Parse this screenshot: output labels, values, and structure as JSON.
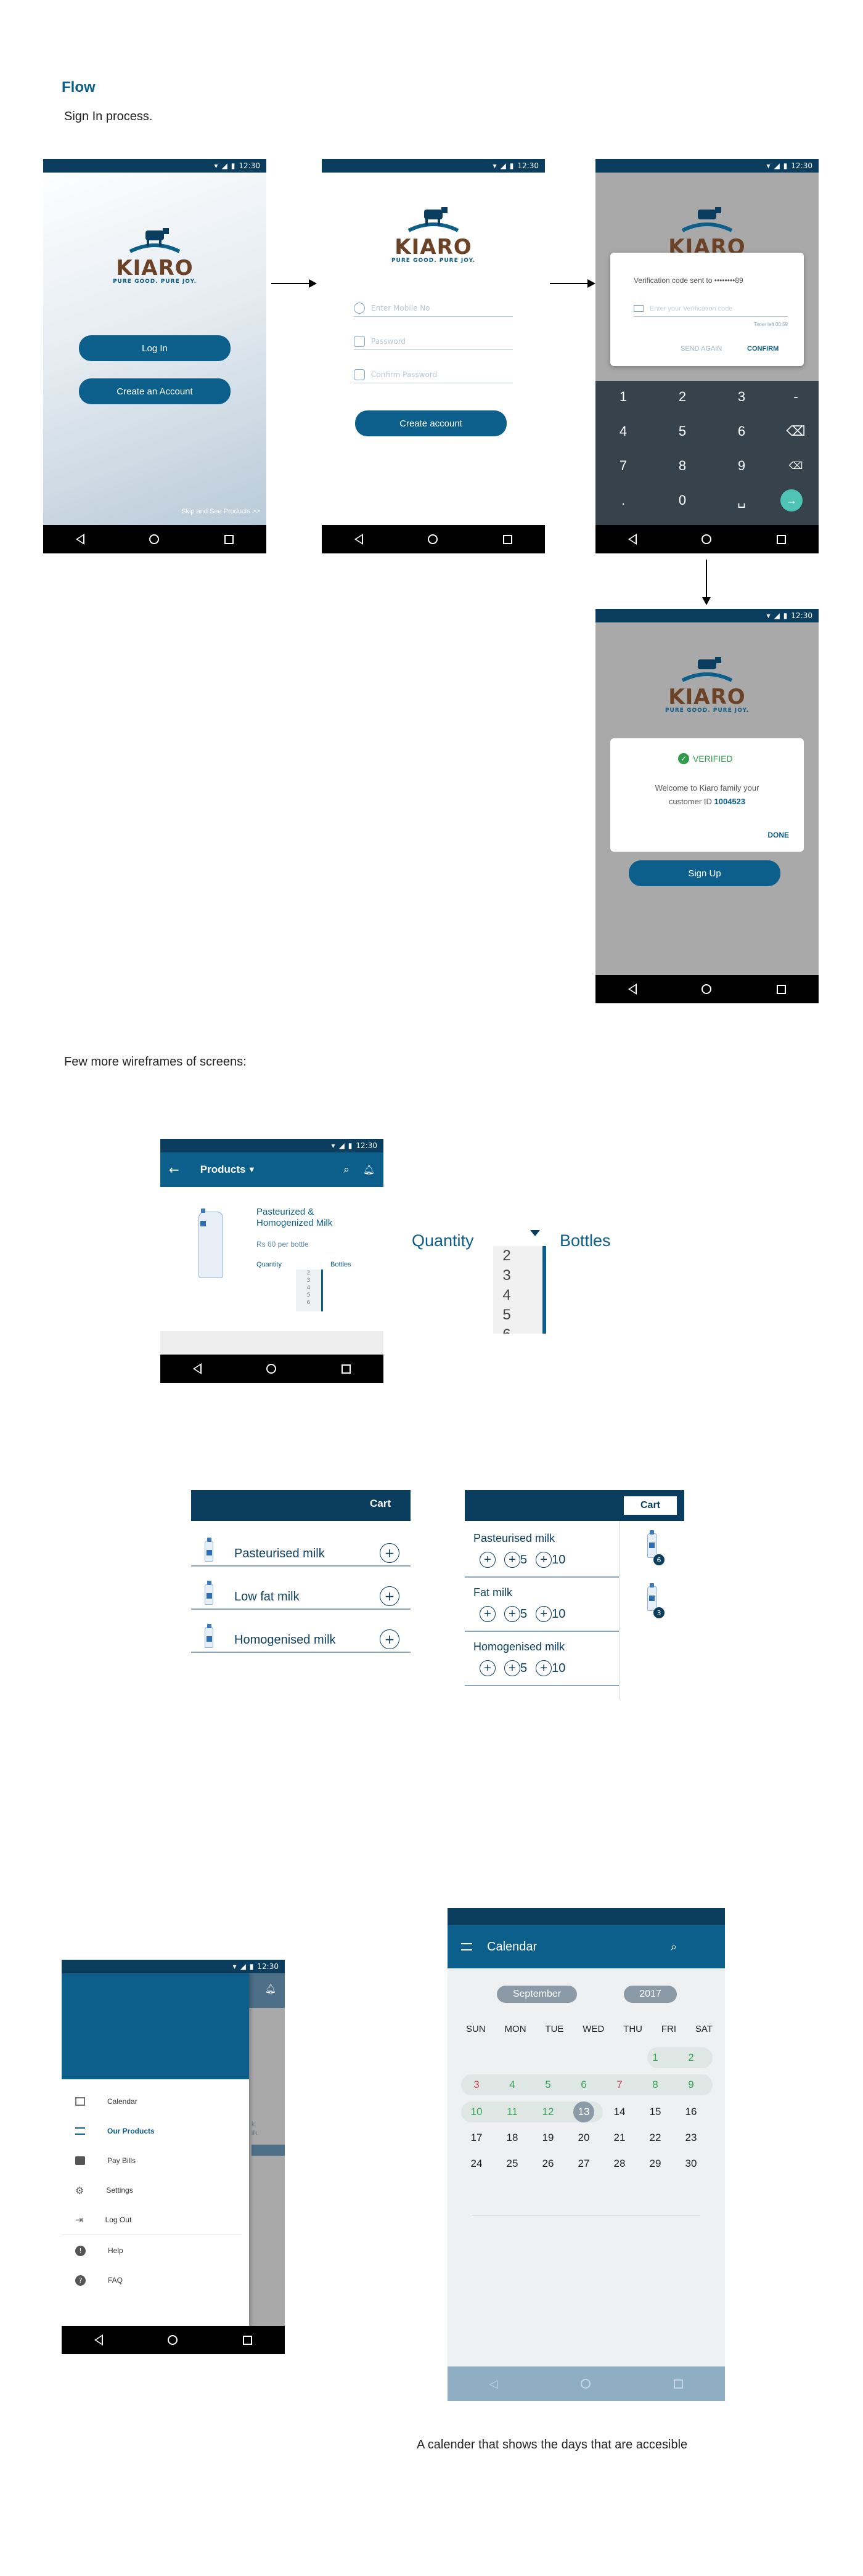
{
  "header": {
    "title": "Flow",
    "subtitle": "Sign In process."
  },
  "status": {
    "time": "12:30"
  },
  "brand": {
    "word": "KIARO",
    "tagline": "PURE GOOD. PURE JOY."
  },
  "screen1": {
    "login": "Log In",
    "create": "Create an Account",
    "skip": "Skip and See Products >>"
  },
  "screen2": {
    "phone_placeholder": "Enter Mobile No",
    "password_placeholder": "Password",
    "confirm_placeholder": "Confirm Password",
    "create": "Create account"
  },
  "screen3": {
    "title": "Verification code sent to ••••••••89",
    "code_placeholder": "Enter your Verification code",
    "timer": "Timer left 00:59",
    "send_again": "SEND AGAIN",
    "confirm": "CONFIRM",
    "keys": [
      "1",
      "2",
      "3",
      "-",
      "4",
      "5",
      "6",
      "⌫",
      "7",
      "8",
      "9",
      "⌫",
      ".",
      "0",
      "␣",
      "→"
    ]
  },
  "screen4": {
    "verified": "VERIFIED",
    "message": "Welcome to Kiaro family your customer ID",
    "customer_id": "1004523",
    "done": "DONE",
    "signup": "Sign Up"
  },
  "section2": {
    "title": "Few more wireframes of screens:"
  },
  "products": {
    "title": "Products",
    "name": "Pasteurized & Homogenized Milk",
    "price": "Rs 60 per bottle",
    "qty_label": "Quantity",
    "bottles_label": "Bottles",
    "picker_values": [
      "2",
      "3",
      "4",
      "5",
      "6"
    ],
    "mini_values": [
      "2",
      "3",
      "4",
      "5",
      "6"
    ]
  },
  "cart1": {
    "title": "Cart",
    "items": [
      "Pasteurised milk",
      "Low fat milk",
      "Homogenised milk"
    ]
  },
  "cart2": {
    "title": "Cart",
    "items": [
      "Pasteurised milk",
      "Fat milk",
      "Homogenised milk"
    ],
    "steps": [
      "5",
      "10"
    ],
    "badges": [
      "6",
      "3"
    ]
  },
  "drawer": {
    "items": [
      "Calendar",
      "Our Products",
      "Pay Bills",
      "Settings",
      "Log Out",
      "Help",
      "FAQ"
    ],
    "peek": "k",
    "peek2": "ilk"
  },
  "calendar": {
    "title": "Calendar",
    "month": "September",
    "year": "2017",
    "weekdays": [
      "SUN",
      "MON",
      "TUE",
      "WED",
      "THU",
      "FRI",
      "SAT"
    ],
    "rows": [
      [
        "",
        "",
        "",
        "",
        "",
        "1",
        "2"
      ],
      [
        "3",
        "4",
        "5",
        "6",
        "7",
        "8",
        "9"
      ],
      [
        "10",
        "11",
        "12",
        "13",
        "14",
        "15",
        "16"
      ],
      [
        "17",
        "18",
        "19",
        "20",
        "21",
        "22",
        "23"
      ],
      [
        "24",
        "25",
        "26",
        "27",
        "28",
        "29",
        "30"
      ]
    ],
    "caption": "A calender that shows the days that are accesible"
  }
}
